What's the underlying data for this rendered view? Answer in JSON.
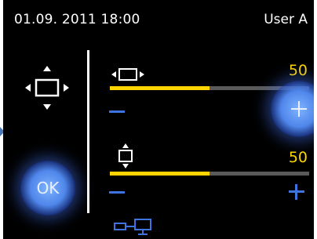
{
  "status_bar": {
    "datetime": "01.09. 2011 18:00",
    "user": "User A"
  },
  "controls": {
    "ok_label": "OK",
    "width": {
      "value": "50",
      "level": 0.5
    },
    "height": {
      "value": "50",
      "level": 0.5
    }
  },
  "colors": {
    "accent": "#ffd400",
    "blue": "#3f74e0",
    "track": "#5a5a5a",
    "background": "#000000"
  },
  "icons": [
    "move-position-icon",
    "width-adjust-icon",
    "height-adjust-icon",
    "minus-icon",
    "plus-icon",
    "screen-link-icon"
  ]
}
